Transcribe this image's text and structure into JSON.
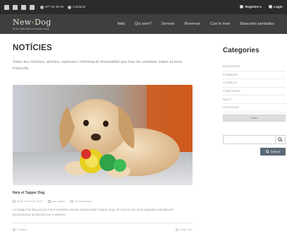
{
  "topbar": {
    "social_icons": [
      "facebook-icon",
      "twitter-icon",
      "youtube-icon",
      "instagram-icon"
    ],
    "phone": "977 61 00 00",
    "contact_label": "Contacte",
    "register_label": "Registre-s",
    "login_label": "Login"
  },
  "header": {
    "logo_part1": "New",
    "logo_part2": "Dog",
    "logo_tagline": "El teu millor amic en bones mans",
    "nav": [
      "Inici",
      "Qui som?",
      "Serveis",
      "Reservar",
      "Can in love",
      "Mascotes perdudes"
    ]
  },
  "main": {
    "title": "NOTÍCIES",
    "intro": "Totes les notícies, articles, opinions i informació d'actualitat que has de conèixer sobre la teva mascota.",
    "post": {
      "image_alt": "puppy-with-toy",
      "title": "Neix el Tupper Dog",
      "date": "20 de Gener de 2018",
      "author": "per_admin",
      "comments": "20 comentaris",
      "excerpt": "La botiga ha llançat una nova iniciativa canina anomenada Tupper Dog. El comerç ha creat aquesta activitat per promocionar productes per a gossos...",
      "category": "Portada",
      "read_more": "Llegir més"
    }
  },
  "sidebar": {
    "title": "Categories",
    "categories": [
      "PRODUCTES",
      "FORMACIÓ",
      "CONSELLS",
      "CONCURSOS",
      "SALUT",
      "LEGISLACIÓ"
    ],
    "all_button": "Totes",
    "search_placeholder": "",
    "search_submit": "Cercar"
  },
  "colors": {
    "topbar_bg": "#2b2b2b",
    "header_bg": "#3f3f3f",
    "logo_accent": "#c7a96b",
    "search_button": "#5c6977"
  }
}
